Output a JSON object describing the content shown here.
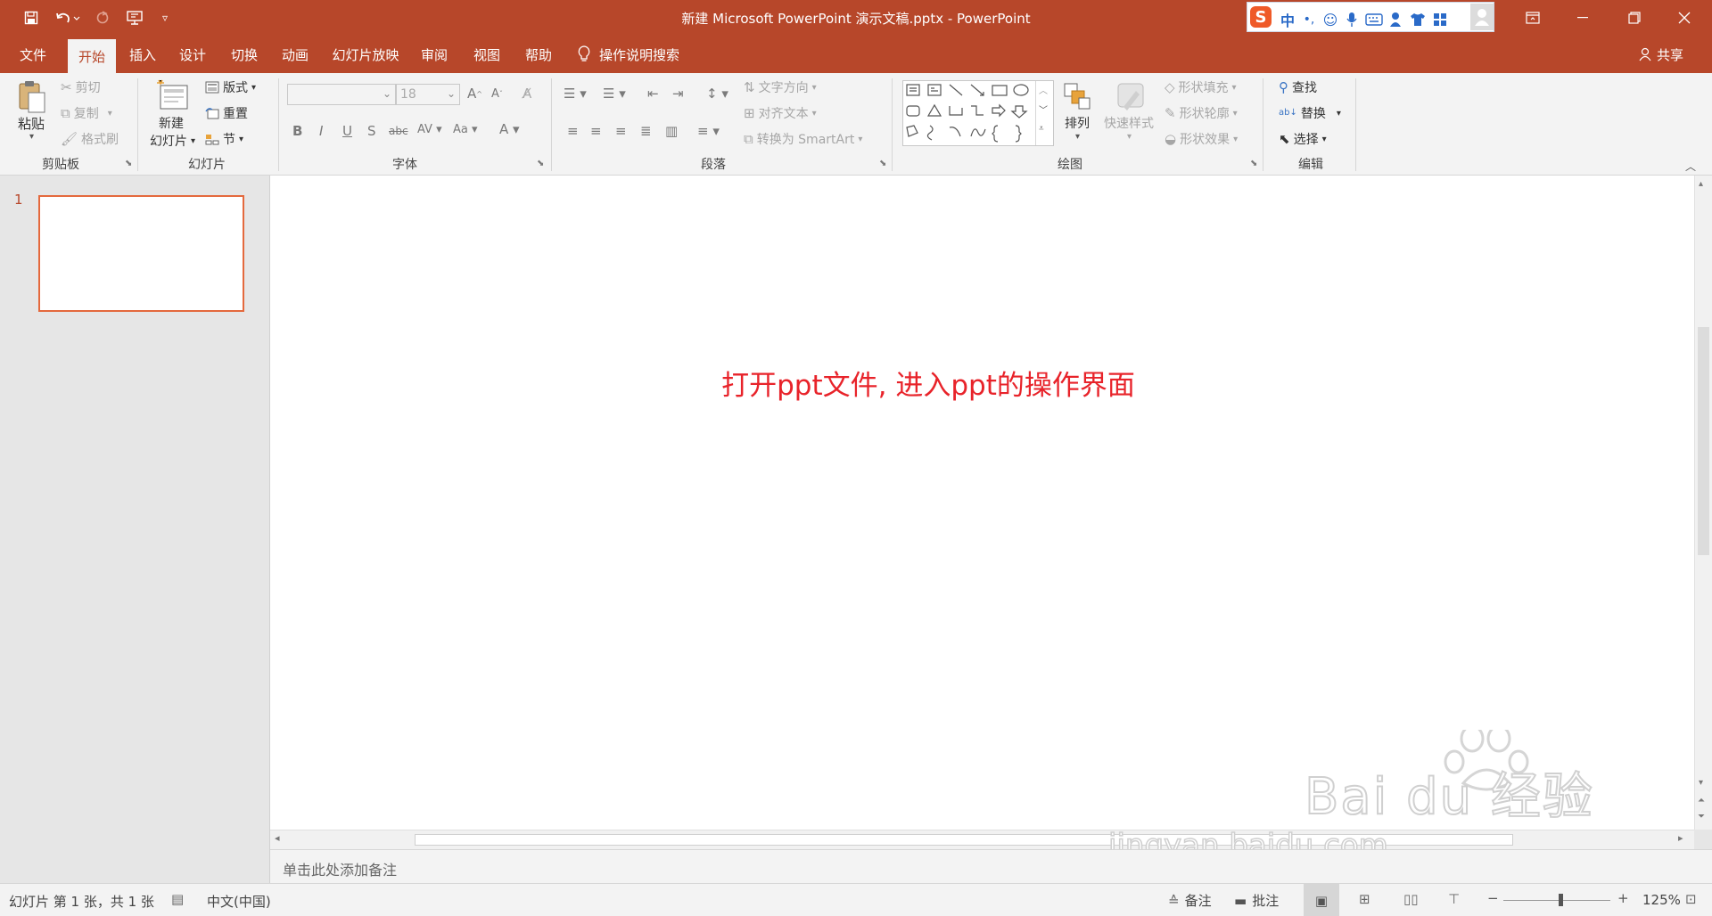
{
  "window": {
    "title": "新建 Microsoft PowerPoint 演示文稿.pptx  -  PowerPoint"
  },
  "quick_access": [
    {
      "name": "save-icon"
    },
    {
      "name": "undo-icon"
    },
    {
      "name": "redo-icon"
    },
    {
      "name": "present-icon"
    },
    {
      "name": "customize-icon"
    }
  ],
  "ime": {
    "mode": "中",
    "punct": "•,"
  },
  "tabs": [
    {
      "label": "文件"
    },
    {
      "label": "开始",
      "active": true
    },
    {
      "label": "插入"
    },
    {
      "label": "设计"
    },
    {
      "label": "切换"
    },
    {
      "label": "动画"
    },
    {
      "label": "幻灯片放映"
    },
    {
      "label": "审阅"
    },
    {
      "label": "视图"
    },
    {
      "label": "帮助"
    }
  ],
  "tell_me": "操作说明搜索",
  "share": "共享",
  "ribbon": {
    "clipboard": {
      "label": "剪贴板",
      "paste": "粘贴",
      "cut": "剪切",
      "copy": "复制",
      "format_painter": "格式刷"
    },
    "slides": {
      "label": "幻灯片",
      "new_slide_line1": "新建",
      "new_slide_line2": "幻灯片",
      "layout": "版式",
      "reset": "重置",
      "section": "节"
    },
    "font": {
      "label": "字体",
      "font_name": "",
      "font_size": "18"
    },
    "paragraph": {
      "label": "段落",
      "text_direction": "文字方向",
      "align_text": "对齐文本",
      "convert_smartart": "转换为 SmartArt"
    },
    "drawing": {
      "label": "绘图",
      "arrange": "排列",
      "quick_styles": "快速样式",
      "shape_fill": "形状填充",
      "shape_outline": "形状轮廓",
      "shape_effects": "形状效果"
    },
    "editing": {
      "label": "编辑",
      "find": "查找",
      "replace": "替换",
      "select": "选择"
    }
  },
  "thumbnail": {
    "number": "1"
  },
  "slide": {
    "caption": "打开ppt文件, 进入ppt的操作界面",
    "caption_color": "#e8232a"
  },
  "notes": {
    "placeholder": "单击此处添加备注"
  },
  "status": {
    "slide_info": "幻灯片 第 1 张，共 1 张",
    "language": "中文(中国)",
    "notes_btn": "备注",
    "comments_btn": "批注",
    "zoom": "125%"
  },
  "watermark": {
    "brand": "Bai du 经验",
    "url": "jingyan.baidu.com"
  },
  "colors": {
    "accent": "#b7472a",
    "thumb_border": "#e4693d"
  }
}
